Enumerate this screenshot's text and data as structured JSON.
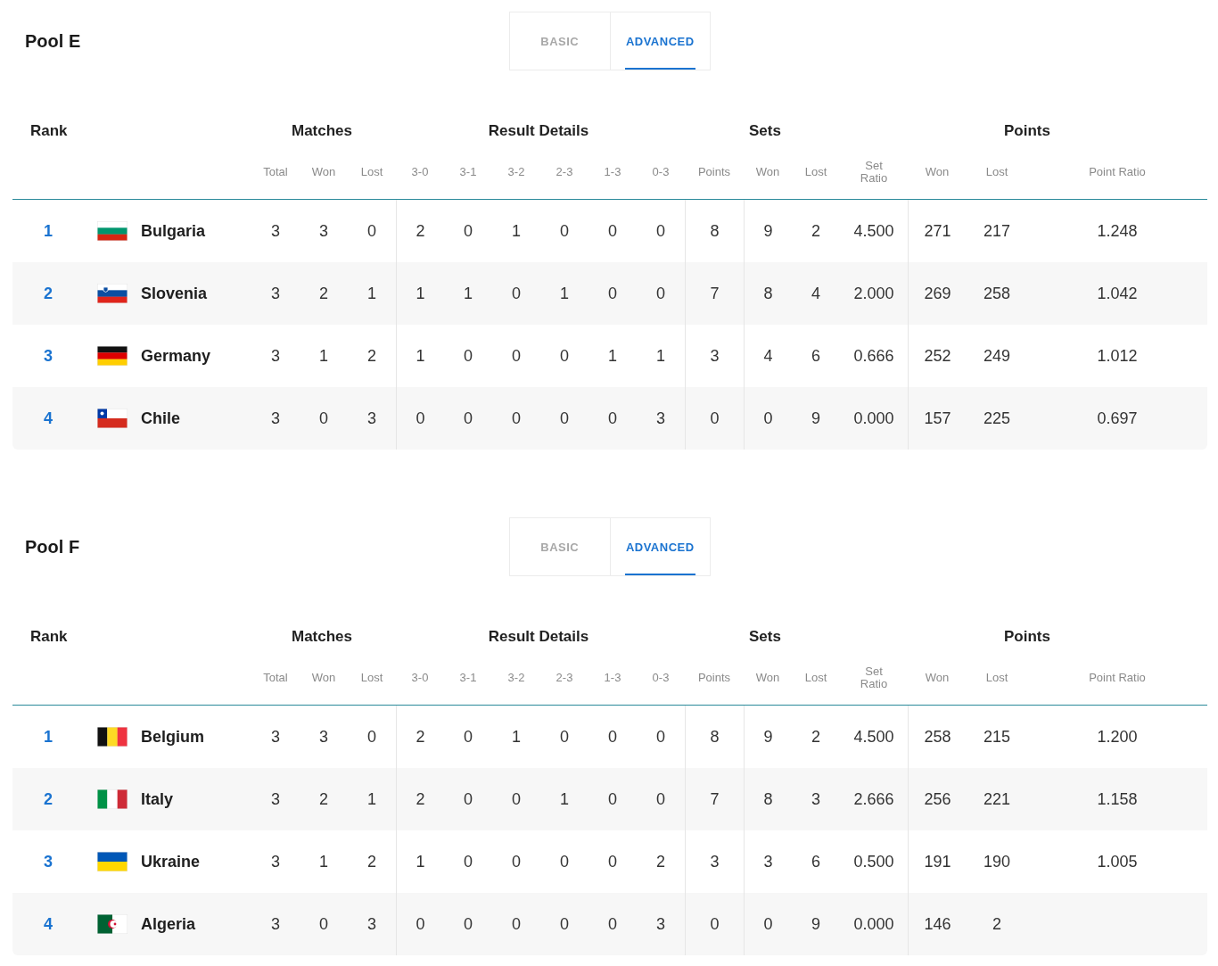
{
  "pools": [
    {
      "title": "Pool E",
      "tabs": [
        {
          "label": "BASIC",
          "selected": false
        },
        {
          "label": "ADVANCED",
          "selected": true
        }
      ],
      "group_headers": [
        "Rank",
        "Matches",
        "Result Details",
        "Sets",
        "Points"
      ],
      "columns": [
        "Total",
        "Won",
        "Lost",
        "3-0",
        "3-1",
        "3-2",
        "2-3",
        "1-3",
        "0-3",
        "Points",
        "Won",
        "Lost",
        "Set Ratio",
        "Won",
        "Lost",
        "Point Ratio"
      ],
      "rows": [
        {
          "rank": "1",
          "kind": "bulgaria",
          "team": "Bulgaria",
          "values": [
            "3",
            "3",
            "0",
            "2",
            "0",
            "1",
            "0",
            "0",
            "0",
            "8",
            "9",
            "2",
            "4.500",
            "271",
            "217",
            "1.248"
          ]
        },
        {
          "rank": "2",
          "kind": "slovenia",
          "team": "Slovenia",
          "values": [
            "3",
            "2",
            "1",
            "1",
            "1",
            "0",
            "1",
            "0",
            "0",
            "7",
            "8",
            "4",
            "2.000",
            "269",
            "258",
            "1.042"
          ]
        },
        {
          "rank": "3",
          "kind": "germany",
          "team": "Germany",
          "values": [
            "3",
            "1",
            "2",
            "1",
            "0",
            "0",
            "0",
            "1",
            "1",
            "3",
            "4",
            "6",
            "0.666",
            "252",
            "249",
            "1.012"
          ]
        },
        {
          "rank": "4",
          "kind": "chile",
          "team": "Chile",
          "values": [
            "3",
            "0",
            "3",
            "0",
            "0",
            "0",
            "0",
            "0",
            "3",
            "0",
            "0",
            "9",
            "0.000",
            "157",
            "225",
            "0.697"
          ]
        }
      ]
    },
    {
      "title": "Pool F",
      "tabs": [
        {
          "label": "BASIC",
          "selected": false
        },
        {
          "label": "ADVANCED",
          "selected": true
        }
      ],
      "group_headers": [
        "Rank",
        "Matches",
        "Result Details",
        "Sets",
        "Points"
      ],
      "columns": [
        "Total",
        "Won",
        "Lost",
        "3-0",
        "3-1",
        "3-2",
        "2-3",
        "1-3",
        "0-3",
        "Points",
        "Won",
        "Lost",
        "Set Ratio",
        "Won",
        "Lost",
        "Point Ratio"
      ],
      "rows": [
        {
          "rank": "1",
          "kind": "belgium",
          "team": "Belgium",
          "values": [
            "3",
            "3",
            "0",
            "2",
            "0",
            "1",
            "0",
            "0",
            "0",
            "8",
            "9",
            "2",
            "4.500",
            "258",
            "215",
            "1.200"
          ]
        },
        {
          "rank": "2",
          "kind": "italy",
          "team": "Italy",
          "values": [
            "3",
            "2",
            "1",
            "2",
            "0",
            "0",
            "1",
            "0",
            "0",
            "7",
            "8",
            "3",
            "2.666",
            "256",
            "221",
            "1.158"
          ]
        },
        {
          "rank": "3",
          "kind": "ukraine",
          "team": "Ukraine",
          "values": [
            "3",
            "1",
            "2",
            "1",
            "0",
            "0",
            "0",
            "0",
            "2",
            "3",
            "3",
            "6",
            "0.500",
            "191",
            "190",
            "1.005"
          ]
        },
        {
          "rank": "4",
          "kind": "algeria",
          "team": "Algeria",
          "values": [
            "3",
            "0",
            "3",
            "0",
            "0",
            "0",
            "0",
            "0",
            "3",
            "0",
            "0",
            "9",
            "0.000",
            "146",
            "2"
          ]
        }
      ]
    }
  ]
}
